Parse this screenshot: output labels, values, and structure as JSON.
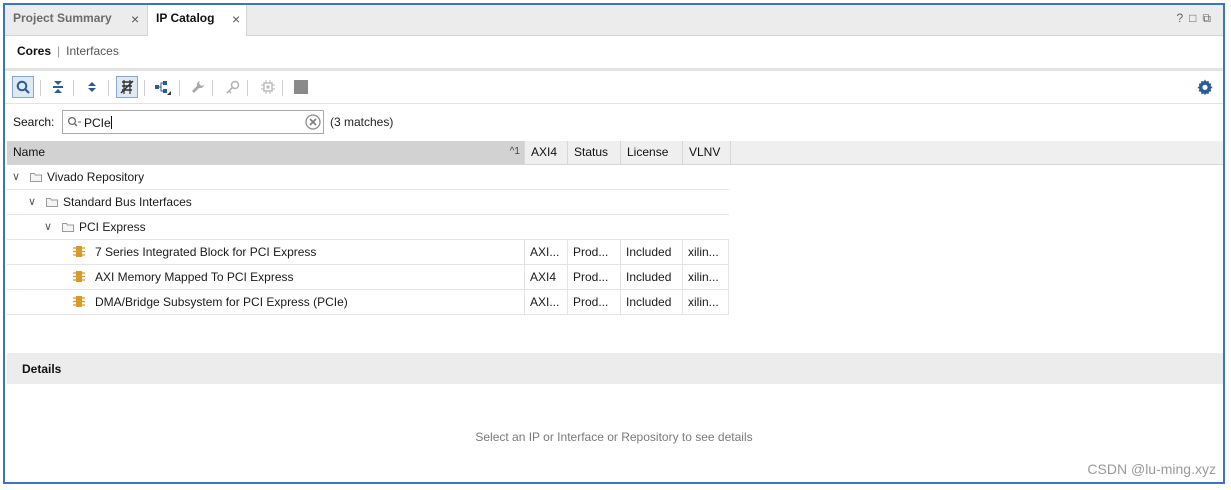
{
  "tabs": [
    {
      "label": "Project Summary",
      "active": false
    },
    {
      "label": "IP Catalog",
      "active": true
    }
  ],
  "subtabs": {
    "current": "Cores",
    "separator": "|",
    "other": "Interfaces"
  },
  "window_controls": "? □ ⧉",
  "search": {
    "label": "Search:",
    "value": "PCIe",
    "matches": "(3 matches)"
  },
  "table": {
    "columns": [
      "Name",
      "AXI4",
      "Status",
      "License",
      "VLNV"
    ],
    "sort_indicator": "^1",
    "tree": [
      {
        "label": "Vivado Repository",
        "level": 0,
        "kind": "folder"
      },
      {
        "label": "Standard Bus Interfaces",
        "level": 1,
        "kind": "folder"
      },
      {
        "label": "PCI Express",
        "level": 2,
        "kind": "folder"
      }
    ],
    "ip_rows": [
      {
        "name": "7 Series Integrated Block for PCI Express",
        "axi4": "AXI...",
        "status": "Prod...",
        "license": "Included",
        "vlnv": "xilin..."
      },
      {
        "name": "AXI Memory Mapped To PCI Express",
        "axi4": "AXI4",
        "status": "Prod...",
        "license": "Included",
        "vlnv": "xilin..."
      },
      {
        "name": "DMA/Bridge Subsystem for PCI Express (PCIe)",
        "axi4": "AXI...",
        "status": "Prod...",
        "license": "Included",
        "vlnv": "xilin..."
      }
    ]
  },
  "details": {
    "title": "Details",
    "hint": "Select an IP or Interface or Repository to see details"
  },
  "watermark": "CSDN @lu-ming.xyz",
  "colors": {
    "accent_border": "#3c74c0",
    "icon_blue": "#2a5d95",
    "ip_orange": "#d89a2c"
  }
}
